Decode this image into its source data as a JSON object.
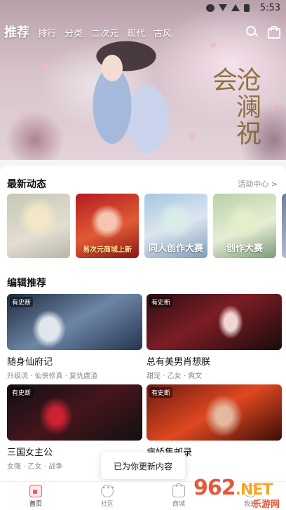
{
  "status_bar": {
    "time": "5:53"
  },
  "top_nav": {
    "current": "推荐",
    "tabs": [
      "排行",
      "分类",
      "二次元",
      "现代",
      "古风"
    ]
  },
  "hero": {
    "calligraphy": "沧澜祝会"
  },
  "latest": {
    "title": "最新动态",
    "link": "活动中心 >",
    "cards": [
      {
        "caption": ""
      },
      {
        "caption": "易次元商城上新"
      },
      {
        "caption": "同人创作大赛"
      },
      {
        "caption": "创作大赛"
      },
      {
        "caption": ""
      }
    ]
  },
  "editor_picks": {
    "title": "编辑推荐",
    "items": [
      {
        "tag": "有史断",
        "title": "随身仙府记",
        "tags": "升级流 · 仙侠修真 · 复仇虐渣"
      },
      {
        "tag": "有史断",
        "title": "总有美男肖想朕",
        "tags": "甜宠 · 乙女 · 爽文"
      },
      {
        "tag": "有史断",
        "title": "三国女主公",
        "tags": "女强 · 乙女 · 战争"
      },
      {
        "tag": "有史断",
        "title": "病娇集邮录",
        "tags": "深 · 乙女"
      }
    ]
  },
  "toast": {
    "text": "已为你更新内容"
  },
  "bottom_nav": {
    "items": [
      {
        "label": "首页",
        "icon": "home-icon"
      },
      {
        "label": "社区",
        "icon": "community-icon"
      },
      {
        "label": "商城",
        "icon": "shop-icon"
      },
      {
        "label": "我的",
        "icon": "profile-icon"
      }
    ]
  },
  "watermark": {
    "brand": "962",
    "suffix": ".NET",
    "sub": "乐游网"
  },
  "colors": {
    "accent": "#f05a6a",
    "watermark": "#e8573a"
  }
}
